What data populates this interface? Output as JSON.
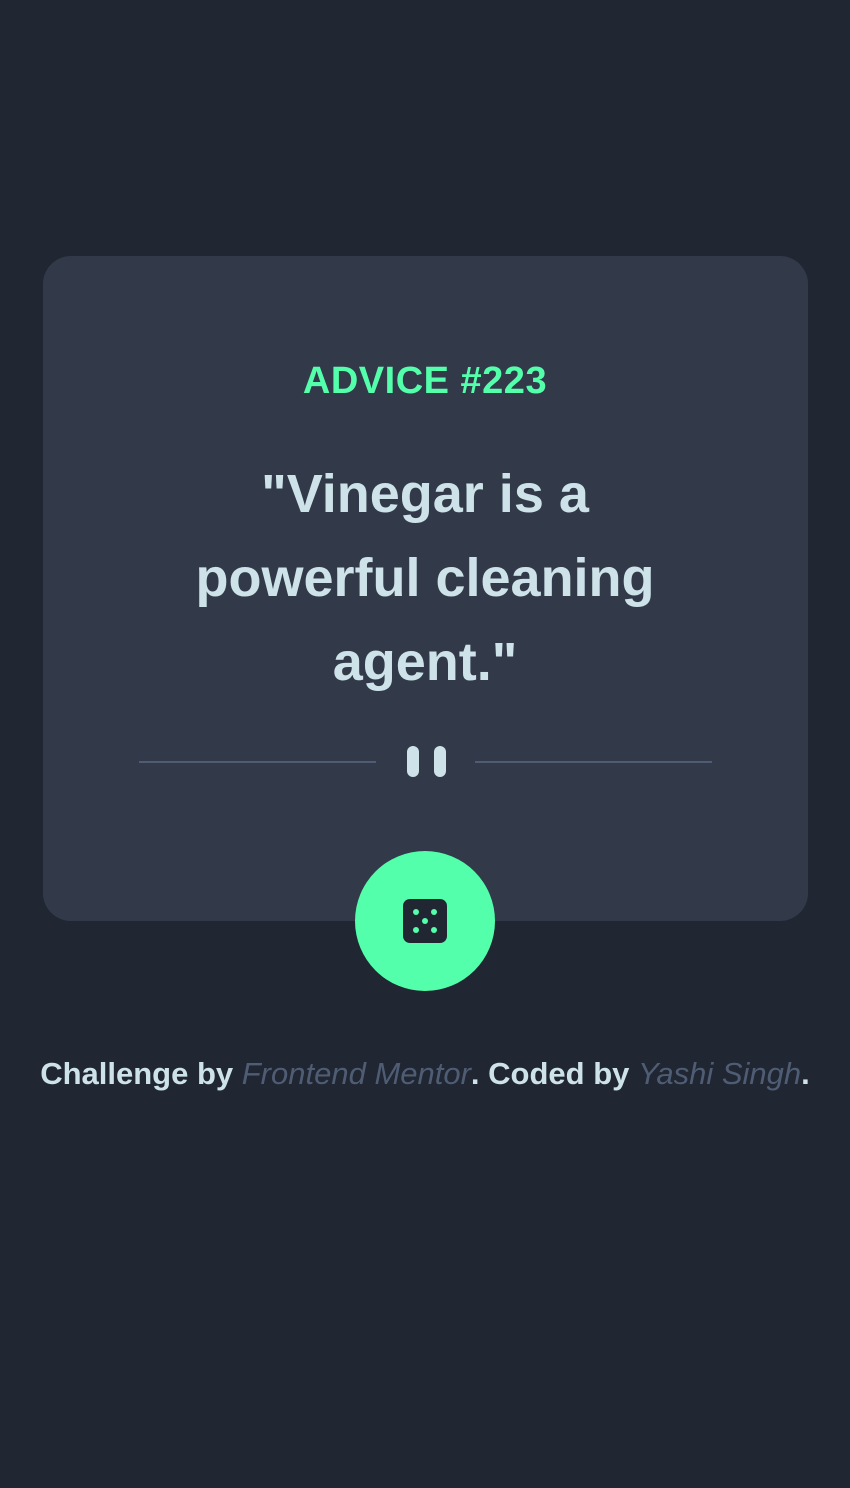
{
  "card": {
    "advice_label": "ADVICE #223",
    "quote": "\"Vinegar is a powerful cleaning agent.\"",
    "divider_icon": "pause-icon",
    "button_icon": "dice-icon"
  },
  "footer": {
    "challenge_prefix": "Challenge by ",
    "challenge_link": "Frontend Mentor",
    "coded_prefix": ". Coded by ",
    "coded_link": "Yashi Singh",
    "suffix": "."
  },
  "colors": {
    "background": "#202632",
    "card": "#323a4a",
    "accent": "#53ffaa",
    "text": "#cee3e9",
    "muted": "#4f5d74"
  }
}
